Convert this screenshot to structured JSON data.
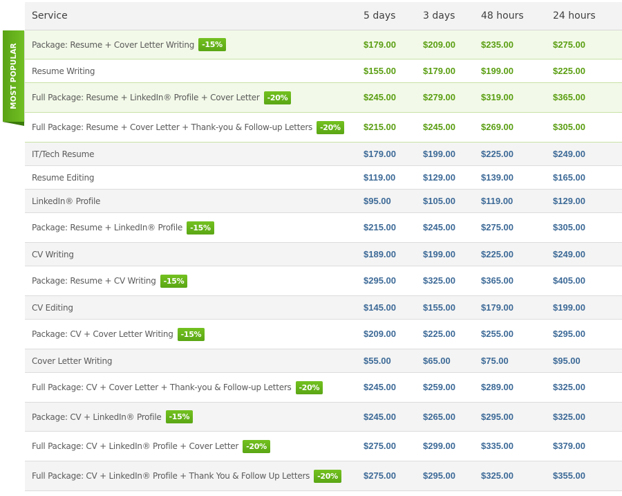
{
  "colors": {
    "popular_price": "#5a9e12",
    "regular_price": "#3d6a97",
    "badge": "#66b31a",
    "ribbon": "#66b31a"
  },
  "ribbon_label": "MOST POPULAR",
  "headers": {
    "service": "Service",
    "t0": "5 days",
    "t1": "3 days",
    "t2": "48 hours",
    "t3": "24 hours"
  },
  "rows": [
    {
      "service": "Package: Resume + Cover Letter Writing",
      "badge": "-15%",
      "prices": [
        "$179.00",
        "$209.00",
        "$235.00",
        "$275.00"
      ],
      "popular": true
    },
    {
      "service": "Resume Writing",
      "badge": "",
      "prices": [
        "$155.00",
        "$179.00",
        "$199.00",
        "$225.00"
      ],
      "popular": true
    },
    {
      "service": "Full Package: Resume + LinkedIn® Profile + Cover Letter",
      "badge": "-20%",
      "prices": [
        "$245.00",
        "$279.00",
        "$319.00",
        "$365.00"
      ],
      "popular": true
    },
    {
      "service": "Full Package: Resume + Cover Letter + Thank-you & Follow-up Letters",
      "badge": "-20%",
      "prices": [
        "$215.00",
        "$245.00",
        "$269.00",
        "$305.00"
      ],
      "popular": true
    },
    {
      "service": "IT/Tech Resume",
      "badge": "",
      "prices": [
        "$179.00",
        "$199.00",
        "$225.00",
        "$249.00"
      ],
      "popular": false
    },
    {
      "service": "Resume Editing",
      "badge": "",
      "prices": [
        "$119.00",
        "$129.00",
        "$139.00",
        "$165.00"
      ],
      "popular": false
    },
    {
      "service": "LinkedIn® Profile",
      "badge": "",
      "prices": [
        "$95.00",
        "$105.00",
        "$119.00",
        "$129.00"
      ],
      "popular": false
    },
    {
      "service": "Package: Resume + LinkedIn® Profile",
      "badge": "-15%",
      "prices": [
        "$215.00",
        "$245.00",
        "$275.00",
        "$305.00"
      ],
      "popular": false
    },
    {
      "service": "CV Writing",
      "badge": "",
      "prices": [
        "$189.00",
        "$199.00",
        "$225.00",
        "$249.00"
      ],
      "popular": false
    },
    {
      "service": "Package: Resume + CV Writing",
      "badge": "-15%",
      "prices": [
        "$295.00",
        "$325.00",
        "$365.00",
        "$405.00"
      ],
      "popular": false
    },
    {
      "service": "CV Editing",
      "badge": "",
      "prices": [
        "$145.00",
        "$155.00",
        "$179.00",
        "$199.00"
      ],
      "popular": false
    },
    {
      "service": "Package: CV + Cover Letter Writing",
      "badge": "-15%",
      "prices": [
        "$209.00",
        "$225.00",
        "$255.00",
        "$295.00"
      ],
      "popular": false
    },
    {
      "service": "Cover Letter Writing",
      "badge": "",
      "prices": [
        "$55.00",
        "$65.00",
        "$75.00",
        "$95.00"
      ],
      "popular": false
    },
    {
      "service": "Full Package: CV + Cover Letter + Thank-you & Follow-up Letters",
      "badge": "-20%",
      "prices": [
        "$245.00",
        "$259.00",
        "$289.00",
        "$325.00"
      ],
      "popular": false
    },
    {
      "service": "Package: CV + LinkedIn® Profile",
      "badge": "-15%",
      "prices": [
        "$245.00",
        "$265.00",
        "$295.00",
        "$325.00"
      ],
      "popular": false
    },
    {
      "service": "Full Package: CV + LinkedIn® Profile + Cover Letter",
      "badge": "-20%",
      "prices": [
        "$275.00",
        "$299.00",
        "$335.00",
        "$379.00"
      ],
      "popular": false
    },
    {
      "service": "Full Package: CV + LinkedIn® Profile + Thank You & Follow Up Letters",
      "badge": "-20%",
      "prices": [
        "$275.00",
        "$295.00",
        "$325.00",
        "$355.00"
      ],
      "popular": false
    }
  ]
}
